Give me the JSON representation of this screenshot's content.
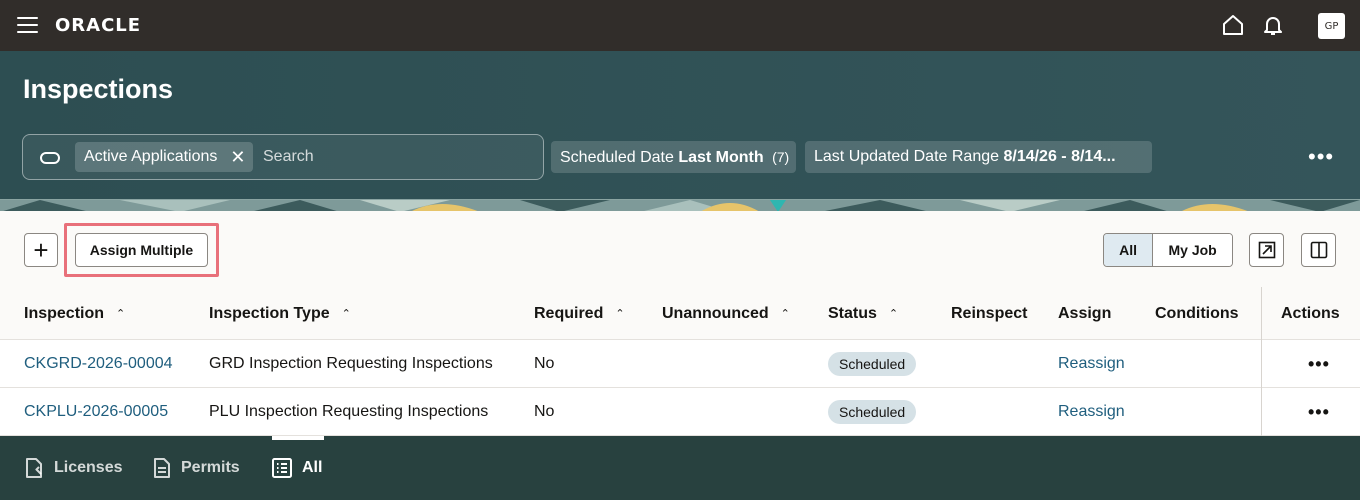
{
  "app": {
    "logo": "ORACLE",
    "user_initials": "GP"
  },
  "header": {
    "title": "Inspections"
  },
  "search": {
    "chip_label": "Active Applications",
    "placeholder": "Search"
  },
  "filters": [
    {
      "prefix": "Scheduled Date ",
      "value": "Last Month",
      "count": "(7)"
    },
    {
      "prefix": "Last Updated Date Range ",
      "value": "8/14/26 - 8/14..."
    }
  ],
  "toolbar": {
    "add_label": "+",
    "assign_multiple_label": "Assign Multiple",
    "segment_all_label": "All",
    "segment_myjob_label": "My Job"
  },
  "table": {
    "columns": [
      "Inspection",
      "Inspection Type",
      "Required",
      "Unannounced",
      "Status",
      "Reinspect",
      "Assign",
      "Conditions",
      "Actions"
    ],
    "rows": [
      {
        "inspection": "CKGRD-2026-00004",
        "type": "GRD Inspection Requesting Inspections",
        "required": "No",
        "unannounced": "",
        "status": "Scheduled",
        "reinspect": "",
        "assign": "Reassign",
        "conditions": ""
      },
      {
        "inspection": "CKPLU-2026-00005",
        "type": "PLU Inspection Requesting Inspections",
        "required": "No",
        "unannounced": "",
        "status": "Scheduled",
        "reinspect": "",
        "assign": "Reassign",
        "conditions": ""
      }
    ]
  },
  "bottom_nav": {
    "tabs": [
      {
        "label": "Licenses",
        "icon": "license-icon"
      },
      {
        "label": "Permits",
        "icon": "document-icon"
      },
      {
        "label": "All",
        "icon": "list-icon",
        "selected": true
      }
    ]
  },
  "colors": {
    "topbar": "#312d2a",
    "header": "#2d4e52",
    "link": "#1f5e7e",
    "highlight": "#e8707a",
    "status_badge": "#d5e1e6",
    "bottom_nav": "#28413f"
  }
}
